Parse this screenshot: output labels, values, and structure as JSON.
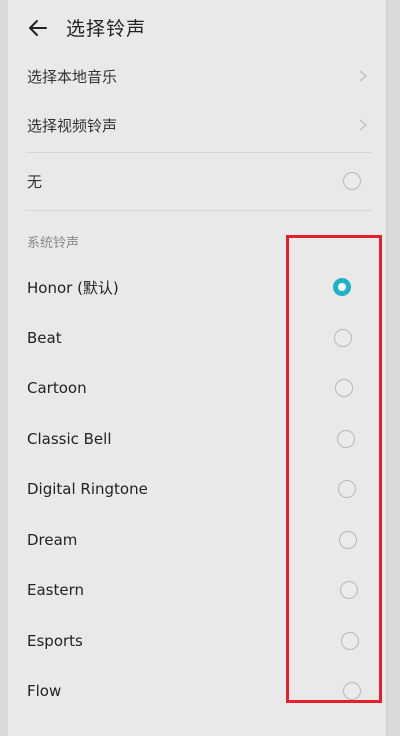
{
  "header": {
    "title": "选择铃声"
  },
  "options": {
    "local_music": "选择本地音乐",
    "video_ringtone": "选择视频铃声",
    "none": "无"
  },
  "section": {
    "title": "系统铃声"
  },
  "ringtones": [
    {
      "label": "Honor (默认)",
      "selected": true
    },
    {
      "label": "Beat",
      "selected": false
    },
    {
      "label": "Cartoon",
      "selected": false
    },
    {
      "label": "Classic Bell",
      "selected": false
    },
    {
      "label": "Digital Ringtone",
      "selected": false
    },
    {
      "label": "Dream",
      "selected": false
    },
    {
      "label": "Eastern",
      "selected": false
    },
    {
      "label": "Esports",
      "selected": false
    },
    {
      "label": "Flow",
      "selected": false
    }
  ],
  "colors": {
    "accent": "#1fb2c6",
    "highlight": "#e5202a"
  },
  "icons": {
    "back": "arrow-left-icon",
    "chevron": "chevron-right-icon"
  }
}
